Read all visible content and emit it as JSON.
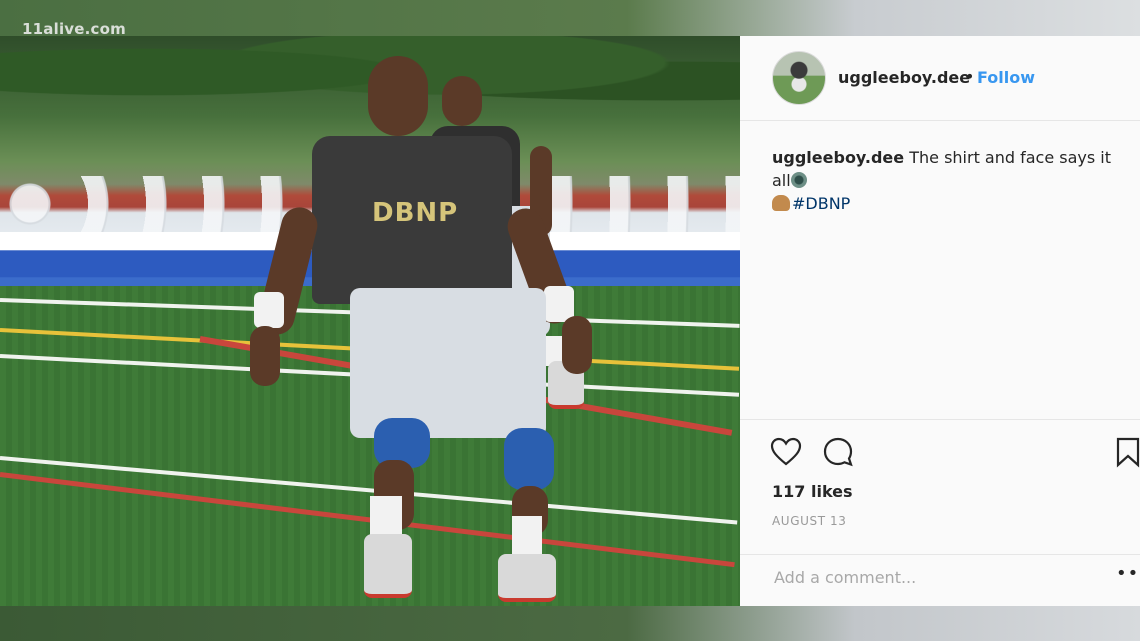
{
  "watermark": {
    "text": "11alive.com"
  },
  "post": {
    "username": "uggleeboy.dee",
    "separator": "•",
    "follow_label": "Follow",
    "photo_shirt_text": "DBNP",
    "caption": {
      "username": "uggleeboy.dee",
      "text": "The shirt and face says it all",
      "hashtag": "#DBNP"
    },
    "likes": "117 likes",
    "date": "AUGUST 13",
    "comment_placeholder": "Add a comment...",
    "more_label": "•••"
  },
  "icons": {
    "avatar": "avatar",
    "like": "heart-icon",
    "comment": "comment-icon",
    "save": "bookmark-icon",
    "emoji_1": "soccer-ball-emoji",
    "emoji_2": "flexed-biceps-emoji"
  },
  "colors": {
    "follow": "#3897f0",
    "text": "#262626",
    "muted": "#999999",
    "card_bg": "#fafafa"
  }
}
